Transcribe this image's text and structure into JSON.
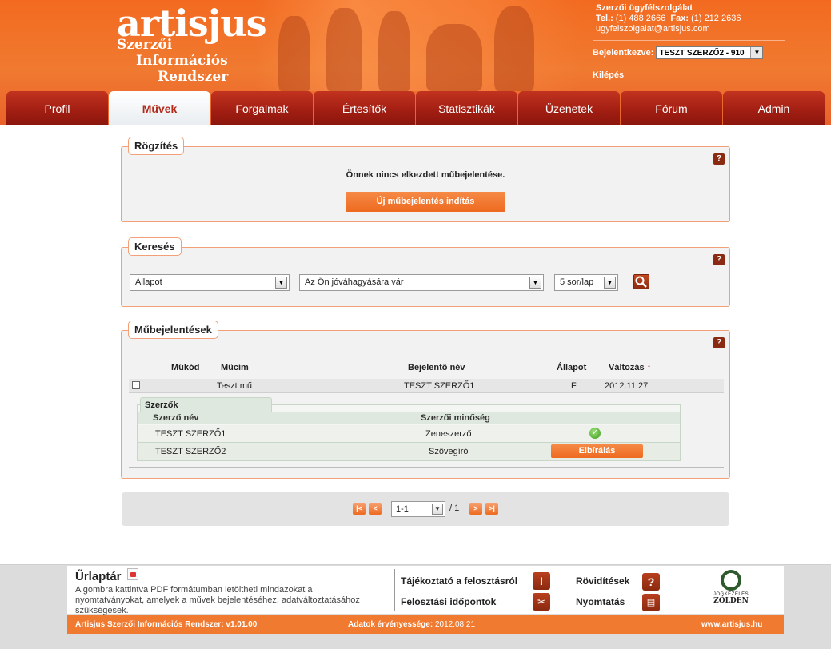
{
  "header": {
    "logo": "artisjus",
    "logo_sub": [
      "Szerzői",
      "Információs",
      "Rendszer"
    ],
    "contact_title": "Szerzői ügyfélszolgálat",
    "tel_label": "Tel.:",
    "tel": "(1) 488 2666",
    "fax_label": "Fax:",
    "fax": "(1) 212 2636",
    "email": "ugyfelszolgalat@artisjus.com",
    "logged_in_label": "Bejelentkezve:",
    "logged_in_user": "TESZT SZERZŐ2 - 910",
    "logout": "Kilépés"
  },
  "nav": {
    "tabs": [
      {
        "label": "Profil"
      },
      {
        "label": "Művek"
      },
      {
        "label": "Forgalmak"
      },
      {
        "label": "Értesítők"
      },
      {
        "label": "Statisztikák"
      },
      {
        "label": "Üzenetek"
      },
      {
        "label": "Fórum"
      },
      {
        "label": "Admin"
      }
    ]
  },
  "record": {
    "title": "Rögzítés",
    "message": "Önnek nincs elkezdett műbejelentése.",
    "new_button": "Új műbejelentés indítás"
  },
  "search": {
    "title": "Keresés",
    "field_select": "Állapot",
    "value_select": "Az Ön jóváhagyására vár",
    "page_size": "5 sor/lap"
  },
  "works": {
    "title": "Műbejelentések",
    "headers": {
      "code": "Műkód",
      "title": "Műcím",
      "reporter": "Bejelentő név",
      "status": "Állapot",
      "changed": "Változás"
    },
    "sort_indicator": "↑",
    "row": {
      "code": "",
      "title": "Teszt mű",
      "reporter": "TESZT SZERZŐ1",
      "status": "F",
      "changed": "2012.11.27"
    },
    "authors_title": "Szerzők",
    "author_headers": {
      "name": "Szerző név",
      "role": "Szerzői minőség"
    },
    "authors": [
      {
        "name": "TESZT SZERZŐ1",
        "role": "Zeneszerző"
      },
      {
        "name": "TESZT SZERZŐ2",
        "role": "Szövegíró",
        "action": "Elbírálás"
      }
    ]
  },
  "pager": {
    "first": "|<",
    "prev": "<",
    "next": ">",
    "last": ">|",
    "current": "1-1",
    "total": "/ 1"
  },
  "footer": {
    "urlaptar_title": "Űrlaptár",
    "urlaptar_desc": "A gombra kattintva PDF formátumban letöltheti mindazokat a nyomtatványokat, amelyek a művek bejelentéséhez, adatváltoztatásához szükségesek.",
    "links": {
      "info": "Tájékoztató a felosztásról",
      "abbrev": "Rövidítések",
      "dates": "Felosztási időpontok",
      "print": "Nyomtatás"
    },
    "eco_logo_line1": "JOGKEZELÉS",
    "eco_logo_line2": "ZÖLDEN",
    "system_version": "Artisjus Szerzői Információs Rendszer: v1.01.00",
    "validity_label": "Adatok érvényessége:",
    "validity_date": "2012.08.21",
    "website": "www.artisjus.hu"
  }
}
